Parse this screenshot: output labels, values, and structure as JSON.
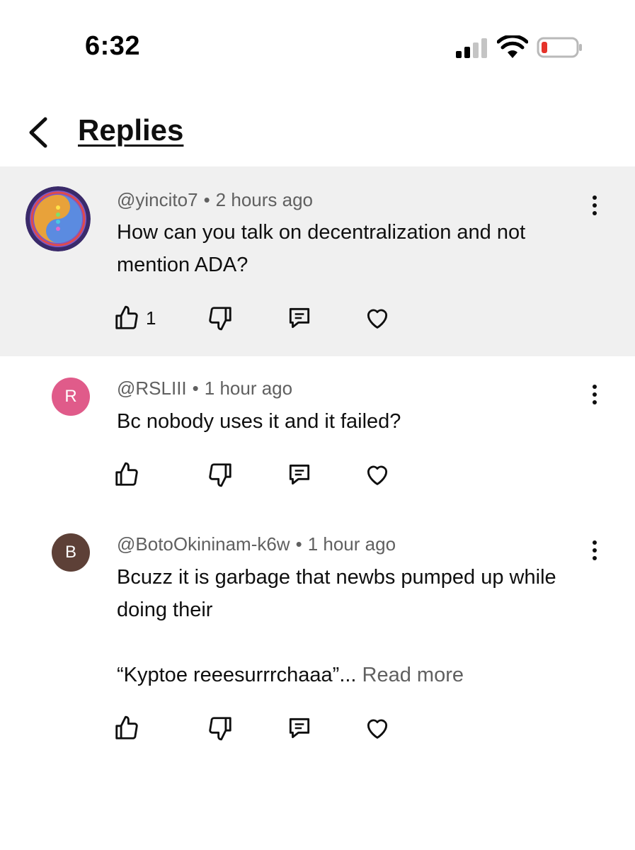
{
  "status_bar": {
    "time": "6:32",
    "icons": [
      "signal-icon",
      "wifi-icon",
      "battery-low-icon"
    ],
    "battery_color": "#e5332a"
  },
  "header": {
    "back_icon": "chevron-left-icon",
    "title": "Replies"
  },
  "comments": [
    {
      "author": "@yincito7",
      "separator": "•",
      "time": "2 hours ago",
      "text": "How can you talk on decentralization and not mention ADA?",
      "read_more": "",
      "likes": "1",
      "avatar_type": "image",
      "highlighted": true
    },
    {
      "author": "@RSLIII",
      "separator": "•",
      "time": "1 hour ago",
      "text": "Bc nobody uses it and it failed?",
      "read_more": "",
      "likes": "",
      "avatar_letter": "R",
      "avatar_color": "#e05b8a",
      "highlighted": false
    },
    {
      "author": "@BotoOkininam-k6w",
      "separator": "•",
      "time": "1 hour ago",
      "text_line1": "Bcuzz it is garbage that newbs pumped up while doing their",
      "text_line2": "“Kyptoe reeesurrrchaaa”...",
      "read_more": "Read more",
      "likes": "",
      "avatar_letter": "B",
      "avatar_color": "#5d4037",
      "highlighted": false
    }
  ],
  "action_icons": [
    "thumbs-up-icon",
    "thumbs-down-icon",
    "reply-comment-icon",
    "heart-icon"
  ],
  "menu_icon": "more-vertical-icon"
}
